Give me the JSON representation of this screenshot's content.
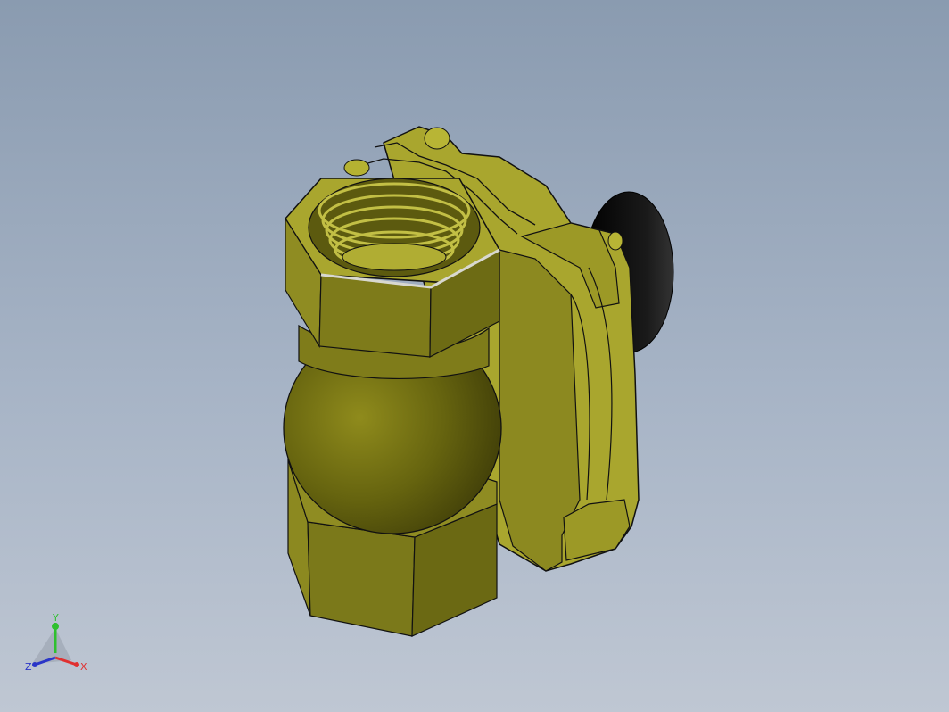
{
  "viewport": {
    "background_top": "#8a9bb0",
    "background_bottom": "#bfc7d3"
  },
  "model": {
    "body_color": "#b5b23a",
    "body_shadow": "#4f4d10",
    "outline_color": "#111111",
    "gasket_color": "#0a0a0a",
    "thread_color": "#7a781e"
  },
  "triad": {
    "x_label": "X",
    "y_label": "Y",
    "z_label": "Z",
    "x_color": "#e03030",
    "y_color": "#2ec02e",
    "z_color": "#2a35c8"
  }
}
